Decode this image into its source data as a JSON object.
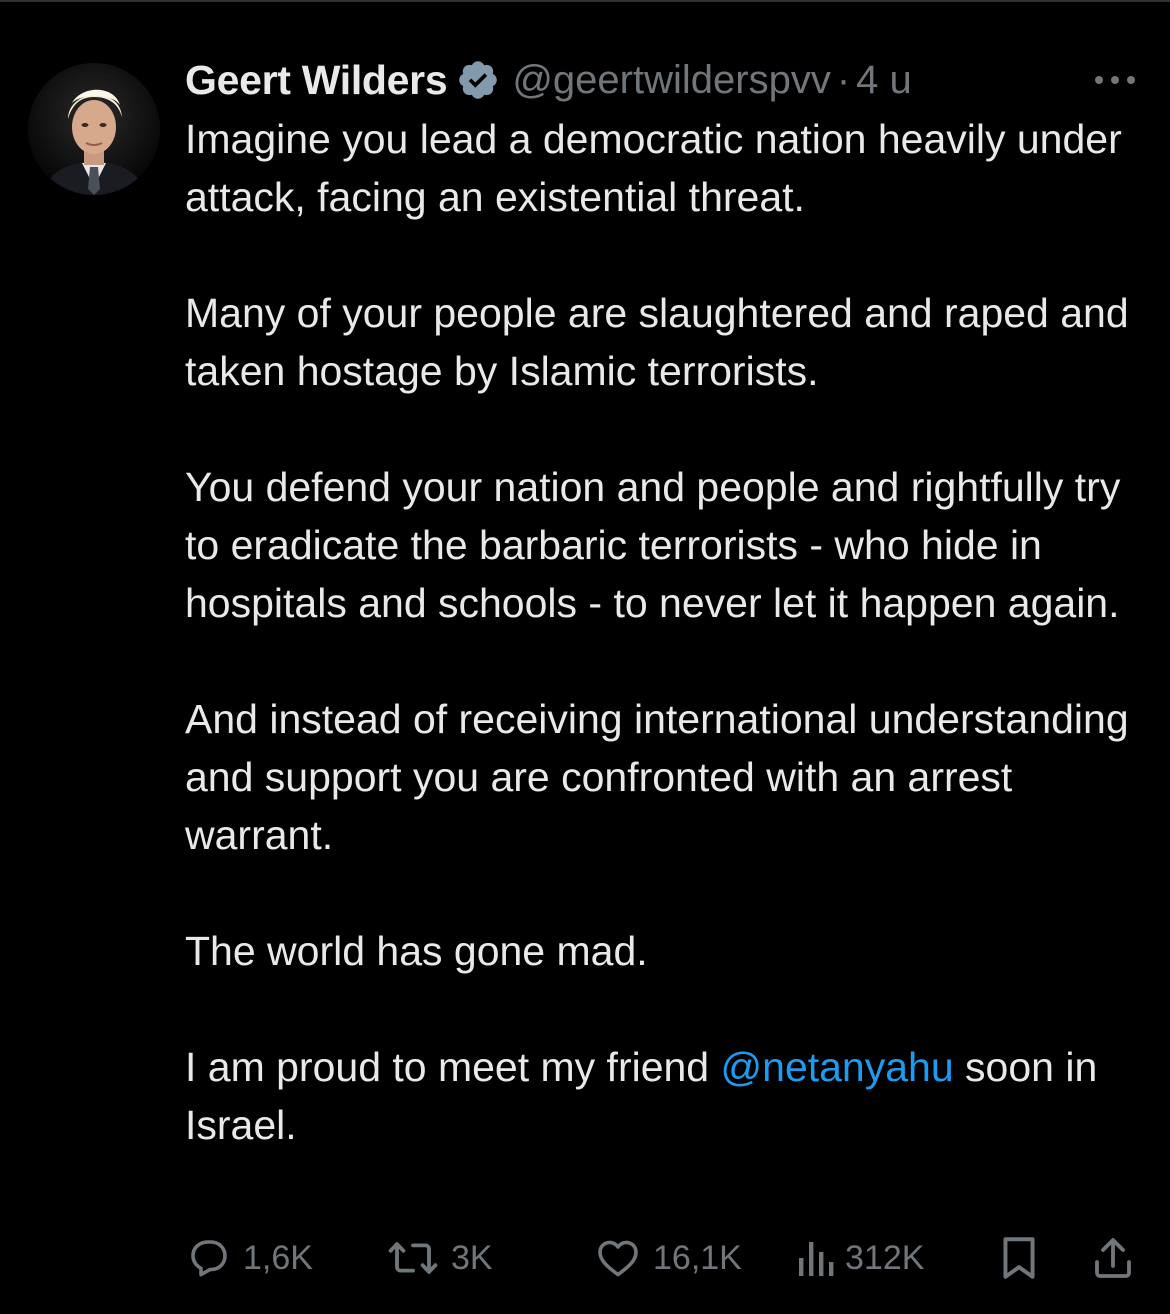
{
  "tweet": {
    "author": {
      "display_name": "Geert Wilders",
      "verified": true,
      "handle": "@geertwilderspvv",
      "avatar_icon": "profile-photo"
    },
    "separator": "·",
    "timestamp": "4 u",
    "paragraphs": [
      "Imagine you lead a democratic nation heavily under attack, facing an existential threat.",
      "Many of your people are slaughtered and raped and taken hostage by Islamic terrorists.",
      "You defend your nation and people and rightfully try to eradicate the barbaric terrorists - who hide in hospitals and schools - to never let it happen again.",
      "And instead of receiving international understanding and support you are confronted with an arrest warrant.",
      "The world has gone mad."
    ],
    "last_paragraph": {
      "before": "I am proud to meet my friend ",
      "mention": "@netanyahu",
      "after": " soon in Israel."
    },
    "metrics": {
      "replies": "1,6K",
      "reposts": "3K",
      "likes": "16,1K",
      "views": "312K"
    }
  },
  "colors": {
    "background": "#000000",
    "text": "#e7e9ea",
    "secondary": "#71767b",
    "mention": "#1d9bf0",
    "verified": "#829aab"
  },
  "icons": {
    "more": "more-horizontal-icon",
    "reply": "reply-icon",
    "repost": "repost-icon",
    "like": "heart-icon",
    "views": "views-icon",
    "bookmark": "bookmark-icon",
    "share": "share-icon"
  }
}
